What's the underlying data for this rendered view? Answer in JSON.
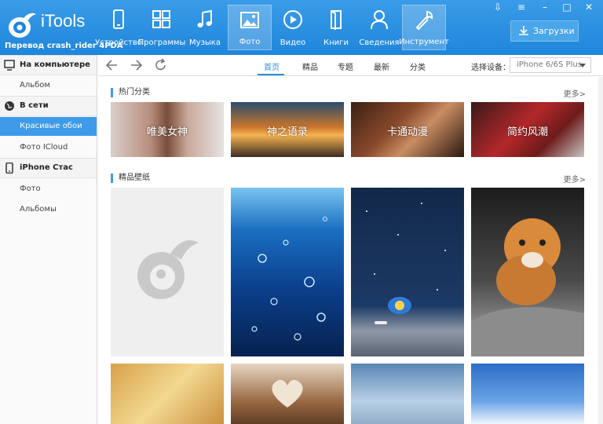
{
  "app": {
    "brand": "iTools",
    "credit": "Перевод crash_rider 4PDA"
  },
  "toolbar": {
    "items": [
      {
        "label": "Устройство",
        "icon": "phone-icon"
      },
      {
        "label": "Программы",
        "icon": "apps-grid-icon"
      },
      {
        "label": "Музыка",
        "icon": "music-note-icon"
      },
      {
        "label": "Фото",
        "icon": "photo-icon"
      },
      {
        "label": "Видео",
        "icon": "play-icon"
      },
      {
        "label": "Книги",
        "icon": "book-icon"
      },
      {
        "label": "Сведения",
        "icon": "person-icon"
      },
      {
        "label": "Инструмент",
        "icon": "wrench-icon"
      }
    ],
    "downloads_label": "Загрузки"
  },
  "sidebar": {
    "sections": [
      {
        "title": "На компьютере",
        "icon": "monitor-icon",
        "items": [
          "Альбом"
        ]
      },
      {
        "title": "В сети",
        "icon": "globe-icon",
        "items": [
          "Красивые обои",
          "Фото ICloud"
        ]
      },
      {
        "title": "iPhone Стас",
        "icon": "iphone-icon",
        "items": [
          "Фото",
          "Альбомы"
        ]
      }
    ],
    "active_item": "Красивые обои"
  },
  "nav": {
    "tabs": [
      "首页",
      "精品",
      "专题",
      "最新",
      "分类"
    ],
    "active_tab": "首页",
    "device_label": "选择设备：",
    "device_value": "iPhone 6/6S Plus"
  },
  "content": {
    "hot_title": "热门分类",
    "featured_title": "精品壁纸",
    "more_label": "更多>",
    "categories": [
      "唯美女神",
      "神之语录",
      "卡通动漫",
      "简约风潮"
    ]
  },
  "colors": {
    "header": "#2a8fe0",
    "accent": "#3d9be9"
  }
}
